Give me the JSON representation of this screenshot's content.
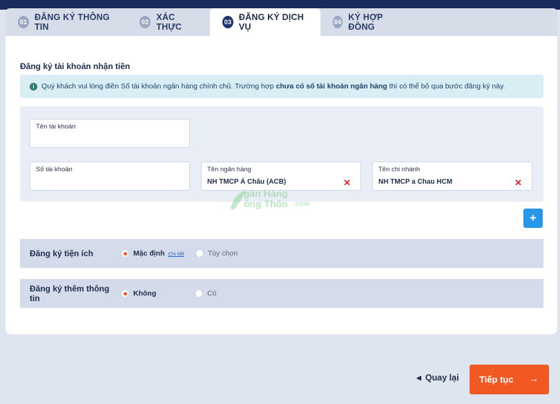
{
  "tabs": [
    {
      "num": "01",
      "label": "ĐĂNG KÝ THÔNG TIN"
    },
    {
      "num": "02",
      "label": "XÁC THỰC"
    },
    {
      "num": "03",
      "label": "ĐĂNG KÝ DỊCH VỤ"
    },
    {
      "num": "04",
      "label": "KÝ HỢP ĐỒNG"
    }
  ],
  "active_tab": "03",
  "section": {
    "title": "Đăng ký tài khoản nhận tiền"
  },
  "info": {
    "icon": "info-icon",
    "text_before": "Quý khách vui lòng điền Số tài khoản ngân hàng chính chủ. Trường hợp",
    "text_bold": "chưa có số tài khoản ngân hàng",
    "text_after": "thì có thể bỏ qua bước đăng ký này."
  },
  "fields": {
    "account_name": {
      "label": "Tên tài khoản",
      "value": ""
    },
    "account_number": {
      "label": "Số tài khoản",
      "value": ""
    },
    "bank_name": {
      "label": "Tên ngân hàng",
      "value": "NH TMCP Á Châu (ACB)"
    },
    "branch_name": {
      "label": "Tên chi nhánh",
      "value": "NH TMCP a Chau HCM"
    }
  },
  "add_button": "+",
  "utilities": {
    "label": "Đăng ký tiện ích",
    "option_default": "Mặc định",
    "detail_link": "Chi tiết",
    "option_custom": "Tùy chọn",
    "selected": "Mặc định"
  },
  "extra_info": {
    "label": "Đăng ký thêm thông tin",
    "option_no": "Không",
    "option_yes": "Có",
    "selected": "Không"
  },
  "watermark": {
    "line1": "gân Hàng",
    "line2": "ông Thôn",
    "suffix": ".com"
  },
  "footer": {
    "back_label": "Quay lại",
    "next_label": "Tiếp tục"
  },
  "colors": {
    "primary_dark": "#1f3672",
    "accent_orange": "#f05a22",
    "add_blue": "#2997e8",
    "error_red": "#e0243a"
  }
}
